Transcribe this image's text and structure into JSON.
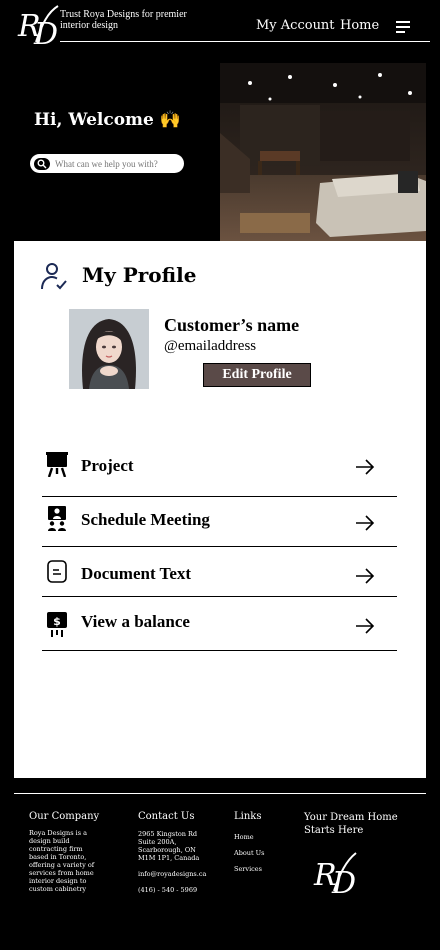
{
  "header": {
    "tagline": "Trust Roya Designs for premier interior design",
    "nav": {
      "my_account": "My Account",
      "home": "Home"
    },
    "menu_icon": "hamburger-menu-icon"
  },
  "hero": {
    "welcome": "Hi, Welcome 🙌",
    "search_placeholder": "What can we help you with?",
    "image": "living-room-basement-photo"
  },
  "profile": {
    "title": "My Profile",
    "icon": "user-check-icon",
    "customer_name": "Customer’s name",
    "email": "@emailaddress",
    "edit_button": "Edit Profile"
  },
  "menu": [
    {
      "label": "Project",
      "icon": "presentation-board-icon"
    },
    {
      "label": "Schedule Meeting",
      "icon": "meeting-people-icon"
    },
    {
      "label": "Document Text",
      "icon": "document-icon"
    },
    {
      "label": "View a balance",
      "icon": "money-icon"
    }
  ],
  "footer": {
    "company": {
      "heading": "Our Company",
      "text": "Roya Designs is a design build contracting firm based in Toronto, offering a variety of services from home interior design to custom cabinetry"
    },
    "contact": {
      "heading": "Contact Us",
      "address": "2965 Kingston Rd Suite 200A, Scarborough, ON M1M 1P1, Canada",
      "email": "info@royadesigns.ca",
      "phone": "(416) - 540 - 5969"
    },
    "links": {
      "heading": "Links",
      "items": [
        "Home",
        "About Us",
        "Services"
      ]
    },
    "dream": {
      "heading": "Your Dream Home Starts Here"
    }
  },
  "colors": {
    "background": "#000000",
    "card": "#ffffff",
    "edit_button": "#5a4a48"
  }
}
